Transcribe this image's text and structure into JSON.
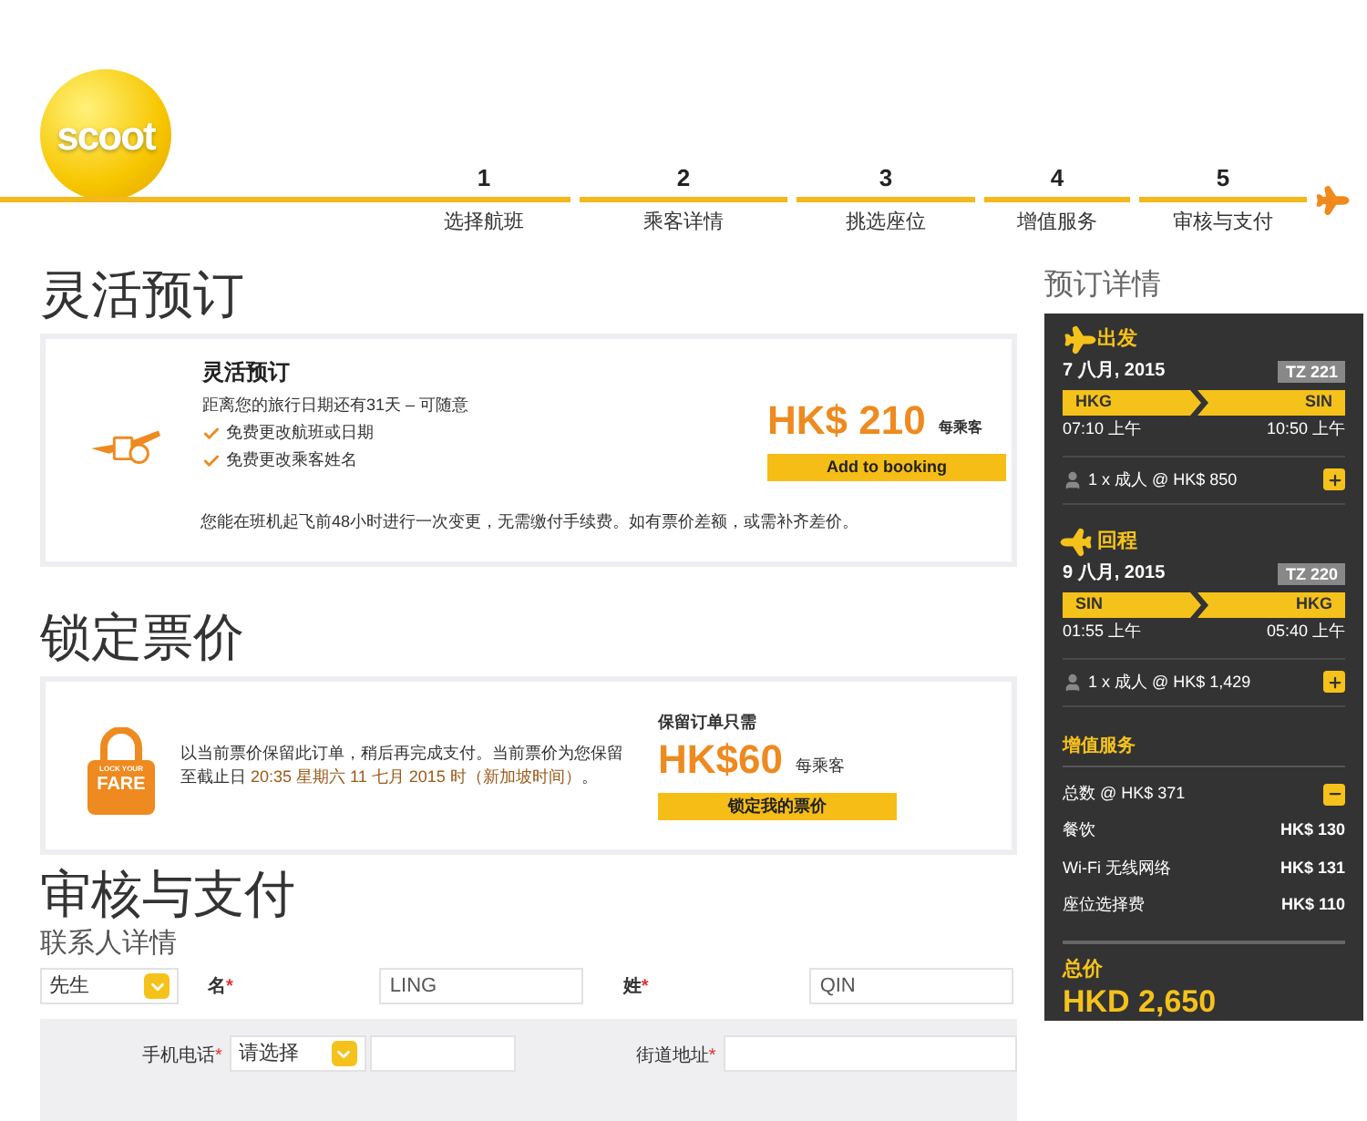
{
  "logo": {
    "text": "scoot"
  },
  "steps": [
    {
      "number": "1",
      "label": "选择航班"
    },
    {
      "number": "2",
      "label": "乘客详情"
    },
    {
      "number": "3",
      "label": "挑选座位"
    },
    {
      "number": "4",
      "label": "增值服务"
    },
    {
      "number": "5",
      "label": "审核与支付"
    }
  ],
  "flexi": {
    "heading": "灵活预订",
    "title": "灵活预订",
    "subtitle": "距离您的旅行日期还有31天 – 可随意",
    "benefits": [
      "免费更改航班或日期",
      "免费更改乘客姓名"
    ],
    "price": "HK$ 210",
    "per": "每乘客",
    "button": "Add to booking",
    "note": "您能在班机起飞前48小时进行一次变更，无需缴付手续费。如有票价差额，或需补齐差价。"
  },
  "lock": {
    "heading": "锁定票价",
    "badge_top": "LOCK YOUR",
    "badge_bottom": "FARE",
    "text": "以当前票价保留此订单，稍后再完成支付。当前票价为您保留至截止日 ",
    "deadline": "20:35 星期六 11 七月 2015 时（新加坡时间）",
    "text_end": "。",
    "price_label": "保留订单只需",
    "price": "HK$60",
    "per": "每乘客",
    "button": "锁定我的票价"
  },
  "review": {
    "heading": "审核与支付",
    "subheading": "联系人详情",
    "title_select": {
      "value": "先生"
    },
    "first_name": {
      "label": "名",
      "mark": "*",
      "value": "LING"
    },
    "last_name": {
      "label": "姓",
      "mark": "*",
      "value": "QIN"
    },
    "mobile": {
      "label": "手机电话",
      "mark": "*",
      "select": "请选择"
    },
    "street": {
      "label": "街道地址",
      "mark": "*"
    }
  },
  "summary": {
    "title": "预订详情",
    "flights": [
      {
        "kind": "departure",
        "label": "出发",
        "date": "7 八月, 2015",
        "flight_no": "TZ 221",
        "from": "HKG",
        "to": "SIN",
        "depart_time": "07:10 上午",
        "arrive_time": "10:50 上午",
        "fare": "1 x 成人 @ HK$ 850",
        "expanded": false
      },
      {
        "kind": "return",
        "label": "回程",
        "date": "9 八月, 2015",
        "flight_no": "TZ 220",
        "from": "SIN",
        "to": "HKG",
        "depart_time": "01:55 上午",
        "arrive_time": "05:40 上午",
        "fare": "1 x 成人 @ HK$ 1,429",
        "expanded": false
      }
    ],
    "addons": {
      "title": "增值服务",
      "total": "总数 @ HK$ 371",
      "expanded": true,
      "items": [
        {
          "name": "餐饮",
          "price": "HK$ 130"
        },
        {
          "name": "Wi-Fi 无线网络",
          "price": "HK$ 131"
        },
        {
          "name": "座位选择费",
          "price": "HK$ 110"
        }
      ]
    },
    "total_label": "总价",
    "total": "HKD 2,650"
  }
}
